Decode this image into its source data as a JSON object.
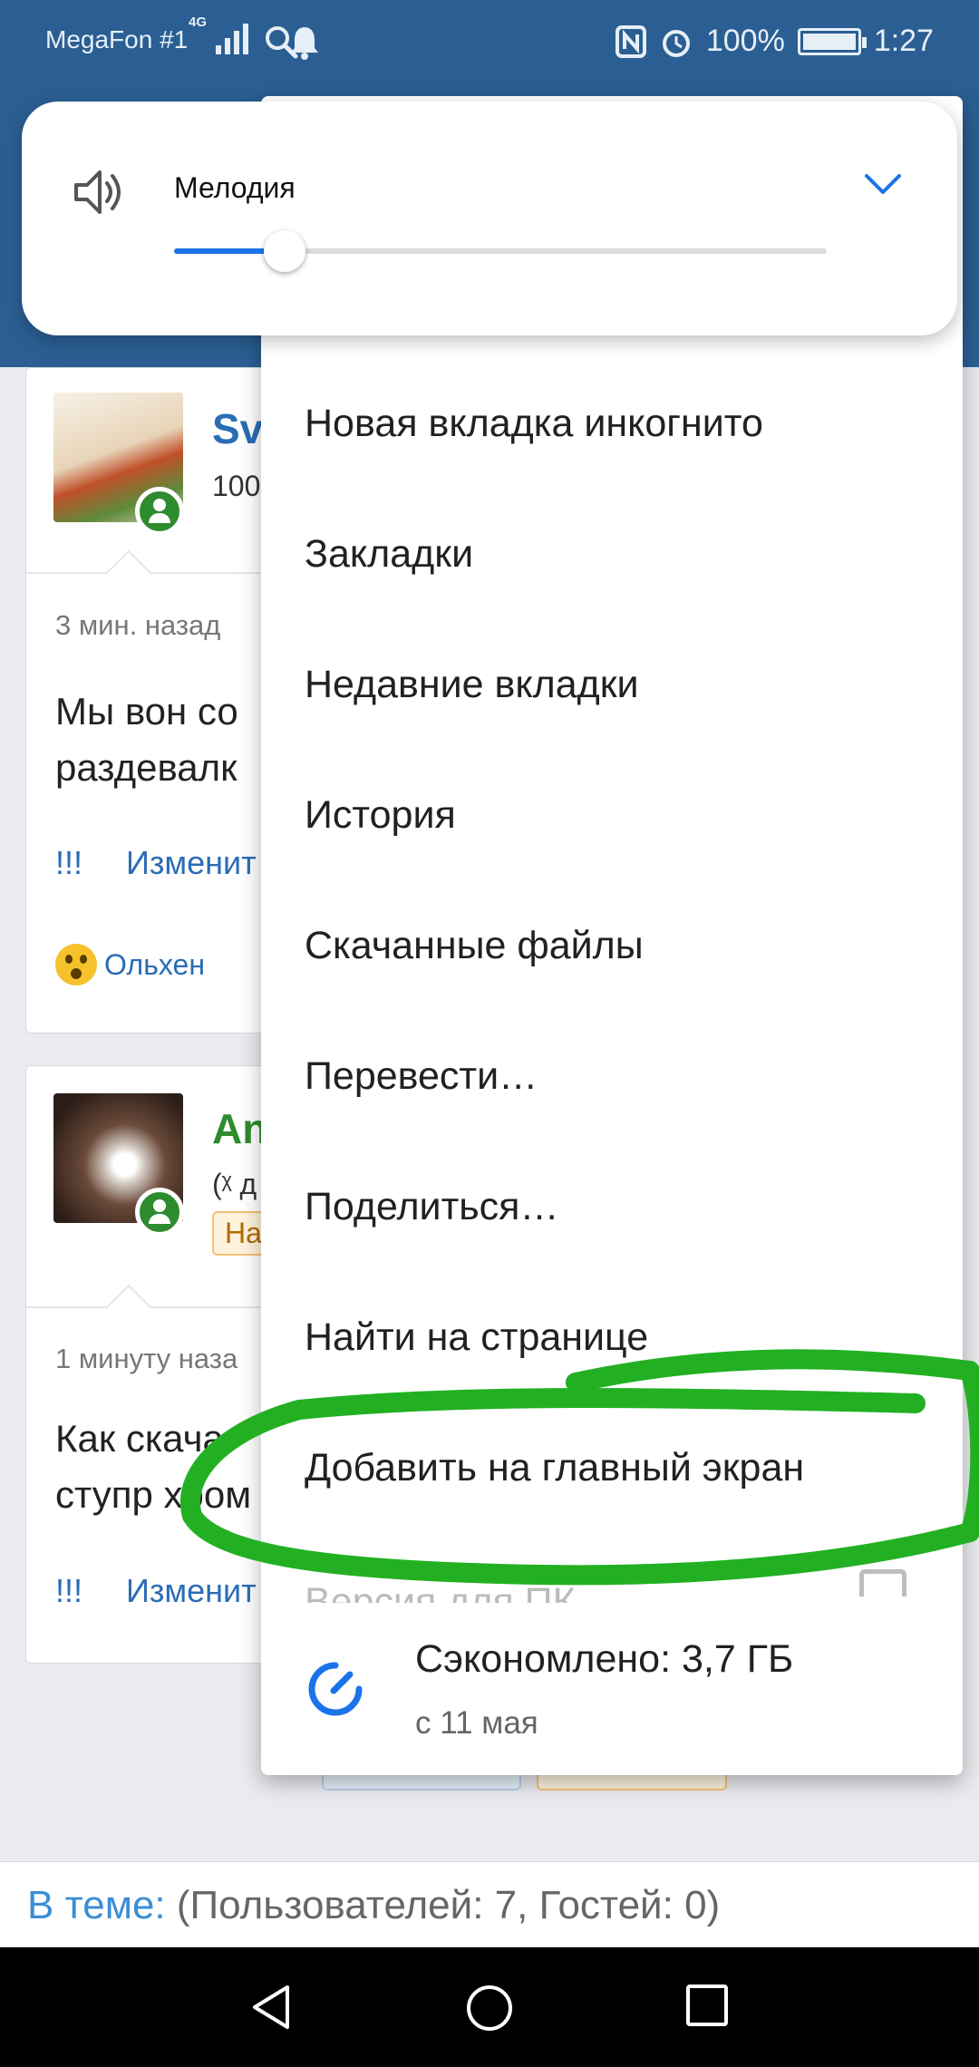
{
  "status_bar": {
    "carrier": "MegaFon #1",
    "network": "4G",
    "battery": "100%",
    "time": "1:27"
  },
  "volume": {
    "label": "Мелодия",
    "level": 0.15
  },
  "posts": [
    {
      "author": "Sv",
      "subtitle": "100",
      "time": "3 мин. назад",
      "text_lines": [
        "Мы вон со",
        "раздевалк"
      ],
      "actions": [
        "!!!",
        "Изменит"
      ],
      "liker": "Ольхен"
    },
    {
      "author": "An",
      "subtitle": "(ᵡ д",
      "badge": "На",
      "time": "1 минуту наза",
      "text_lines": [
        "Как скача",
        "ступр хром"
      ],
      "actions": [
        "!!!",
        "Изменит"
      ]
    }
  ],
  "menu": {
    "items": [
      "Новая вкладка инкогнито",
      "Закладки",
      "Недавние вкладки",
      "История",
      "Скачанные файлы",
      "Перевести…",
      "Поделиться…",
      "Найти на странице",
      "Добавить на главный экран"
    ],
    "partial_item": "Версия для ПК",
    "saved_title": "Сэкономлено: 3,7 ГБ",
    "saved_subtitle": "с 11 мая"
  },
  "footer": {
    "label": "В теме:",
    "value": "(Пользователей: 7, Гостей: 0)"
  },
  "colors": {
    "header": "#2b5f93",
    "link": "#2a6db5",
    "accent": "#1a73e8",
    "online": "#2e8b2e",
    "scribble": "#22b022"
  }
}
